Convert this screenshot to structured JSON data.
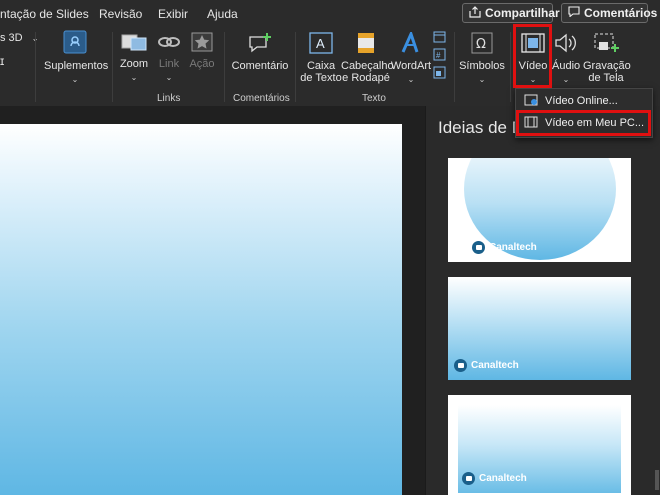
{
  "tabs": [
    {
      "label": "ntação de Slides"
    },
    {
      "label": "Revisão"
    },
    {
      "label": "Exibir"
    },
    {
      "label": "Ajuda"
    }
  ],
  "topbar": {
    "share_label": "Compartilhar",
    "comments_label": "Comentários"
  },
  "ribbon": {
    "partial_3d_label": "s 3D",
    "suplementos_label": "Suplementos",
    "zoom_label": "Zoom",
    "link_label": "Link",
    "acao_label": "Ação",
    "links_group": "Links",
    "comentario_label": "Comentário",
    "comentarios_group": "Comentários",
    "caixa_texto_line1": "Caixa",
    "caixa_texto_line2": "de Texto",
    "cabecalho_line1": "Cabeçalho",
    "cabecalho_line2": "e Rodapé",
    "wordart_label": "WordArt",
    "texto_group": "Texto",
    "simbolos_label": "Símbolos",
    "video_label": "Vídeo",
    "audio_label": "Áudio",
    "gravacao_line1": "Gravação",
    "gravacao_line2": "de Tela"
  },
  "dropdown": {
    "item_online": "Vídeo Online...",
    "item_pc": "Vídeo em Meu PC..."
  },
  "design_pane": {
    "title": "Ideias de D",
    "brand": "Canaltech"
  },
  "colors": {
    "highlight": "#e01010",
    "slide_blue": "#5fb7e4"
  }
}
